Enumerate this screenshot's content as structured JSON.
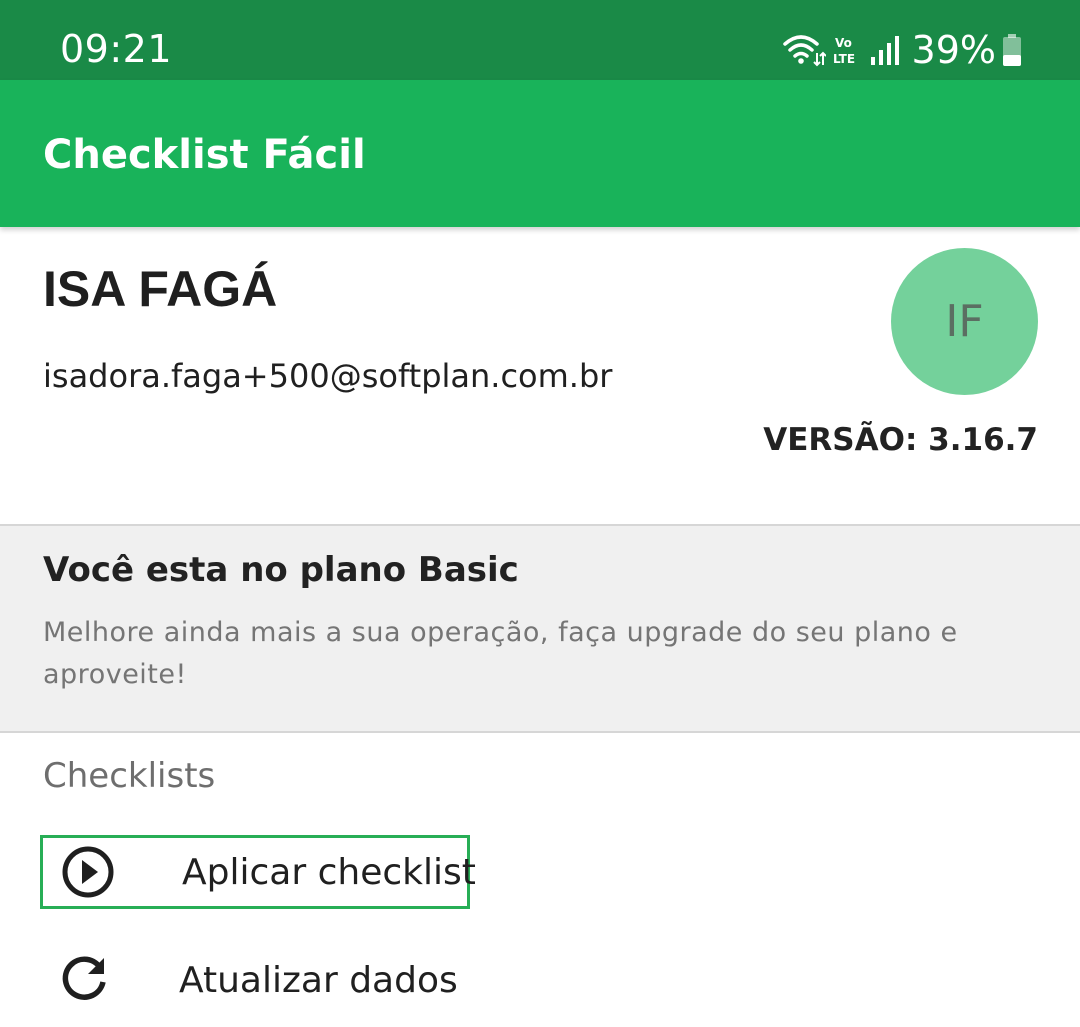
{
  "status_bar": {
    "time": "09:21",
    "battery": "39%",
    "icons": [
      "wifi-icon",
      "volte-icon",
      "signal-icon",
      "battery-icon"
    ]
  },
  "app_bar": {
    "title": "Checklist Fácil"
  },
  "profile": {
    "name": "ISA FAGÁ",
    "email": "isadora.faga+500@softplan.com.br",
    "avatar_initials": "IF",
    "version": "VERSÃO: 3.16.7"
  },
  "plan": {
    "title": "Você esta no plano Basic",
    "description": "Melhore ainda mais a sua operação, faça upgrade do seu plano e aproveite!"
  },
  "menu": {
    "section_label": "Checklists",
    "items": [
      {
        "label": "Aplicar checklist",
        "icon": "play-circle-icon"
      },
      {
        "label": "Atualizar dados",
        "icon": "refresh-icon"
      }
    ]
  },
  "colors": {
    "status_bar": "#1a8a47",
    "app_bar": "#19b35a",
    "avatar": "#74d19b",
    "highlight_border": "#27ae56",
    "plan_background": "#f0f0f0"
  }
}
